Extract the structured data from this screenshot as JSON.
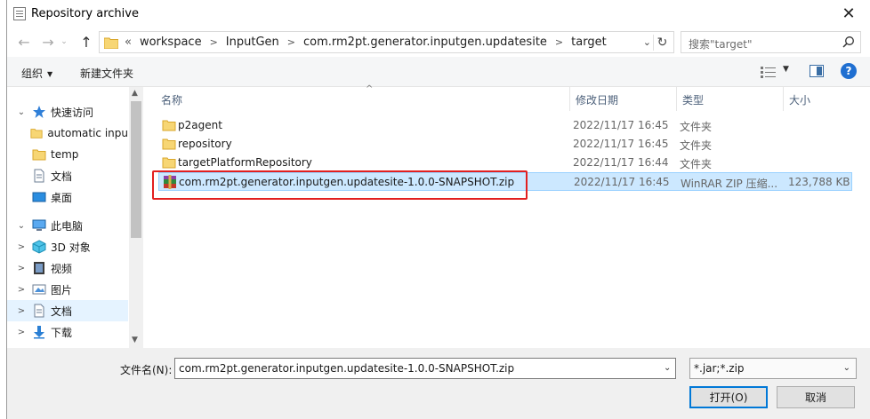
{
  "window": {
    "title": "Repository archive"
  },
  "address": {
    "lead": "«",
    "crumbs": [
      "workspace",
      "InputGen",
      "com.rm2pt.generator.inputgen.updatesite",
      "target"
    ]
  },
  "search": {
    "placeholder": "搜索\"target\""
  },
  "toolbar": {
    "organize": "组织",
    "new_folder": "新建文件夹"
  },
  "nav_pane": {
    "items": [
      {
        "label": "快速访问",
        "expander": "⌄",
        "icon": "star-icon"
      },
      {
        "label": "automatic inpu",
        "expander": "",
        "icon": "folder-icon"
      },
      {
        "label": "temp",
        "expander": "",
        "icon": "folder-icon"
      },
      {
        "label": "文档",
        "expander": "",
        "icon": "document-icon"
      },
      {
        "label": "桌面",
        "expander": "",
        "icon": "desktop-icon"
      },
      {
        "label": "此电脑",
        "expander": "⌄",
        "icon": "computer-icon"
      },
      {
        "label": "3D 对象",
        "expander": ">",
        "icon": "cube-icon"
      },
      {
        "label": "视频",
        "expander": ">",
        "icon": "video-icon"
      },
      {
        "label": "图片",
        "expander": ">",
        "icon": "picture-icon"
      },
      {
        "label": "文档",
        "expander": ">",
        "icon": "document-icon",
        "selected": true
      },
      {
        "label": "下载",
        "expander": ">",
        "icon": "download-icon"
      }
    ]
  },
  "columns": {
    "name": "名称",
    "date": "修改日期",
    "type": "类型",
    "size": "大小"
  },
  "files": [
    {
      "name": "p2agent",
      "date": "2022/11/17 16:45",
      "type": "文件夹",
      "size": "",
      "icon": "folder-icon"
    },
    {
      "name": "repository",
      "date": "2022/11/17 16:45",
      "type": "文件夹",
      "size": "",
      "icon": "folder-icon"
    },
    {
      "name": "targetPlatformRepository",
      "date": "2022/11/17 16:44",
      "type": "文件夹",
      "size": "",
      "icon": "folder-icon"
    },
    {
      "name": "com.rm2pt.generator.inputgen.updatesite-1.0.0-SNAPSHOT.zip",
      "date": "2022/11/17 16:45",
      "type": "WinRAR ZIP 压缩...",
      "size": "123,788 KB",
      "icon": "winrar-zip-icon",
      "selected": true
    }
  ],
  "bottom": {
    "filename_label": "文件名(N):",
    "filename_value": "com.rm2pt.generator.inputgen.updatesite-1.0.0-SNAPSHOT.zip",
    "filter_value": "*.jar;*.zip",
    "open_label": "打开(O)",
    "cancel_label": "取消"
  },
  "colors": {
    "selection": "#cce8ff",
    "highlight_box": "#e22020",
    "accent": "#0078d7"
  }
}
